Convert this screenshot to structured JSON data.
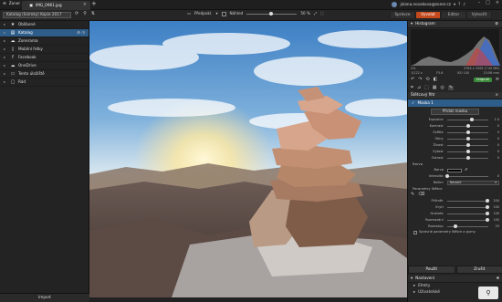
{
  "topbar": {
    "menu_label": "Zoner",
    "tab_title": "IMG_0961.jpg",
    "user_email": "jolana.novakova@zoner.cz",
    "window_controls": [
      "minimize",
      "maximize",
      "close"
    ]
  },
  "toolbar": {
    "catalog_select": "Katalog (Snímky) Kopie 2017",
    "view_label": "Předpokl.",
    "compare_label": "Náhled",
    "zoom": "50 %"
  },
  "modes": [
    "Správce",
    "Vyvolat",
    "Editor",
    "Vytvořit"
  ],
  "active_mode": "Vyvolat",
  "sidebar": {
    "items": [
      {
        "label": "Oblíbené",
        "icon": "star-icon",
        "selected": false,
        "extra": ""
      },
      {
        "label": "Katalog",
        "icon": "catalog-icon",
        "selected": true,
        "extra": "⚙ ◷"
      },
      {
        "label": "Zonerama",
        "icon": "cloud-icon",
        "selected": false,
        "extra": ""
      },
      {
        "label": "Mobilní řetky",
        "icon": "phone-icon",
        "selected": false,
        "extra": ""
      },
      {
        "label": "Facebook",
        "icon": "facebook-icon",
        "selected": false,
        "extra": ""
      },
      {
        "label": "OneDrive",
        "icon": "onedrive-icon",
        "selected": false,
        "extra": ""
      },
      {
        "label": "Tento úložiště",
        "icon": "computer-icon",
        "selected": false,
        "extra": ""
      },
      {
        "label": "Rád",
        "icon": "folder-icon",
        "selected": false,
        "extra": ""
      }
    ],
    "import_label": "Import"
  },
  "right": {
    "histogram_title": "Histogram",
    "hist_info_left": "2%",
    "hist_info_mid": "3784 x 2506 (7.40 MB)",
    "hist_info_row2": [
      "1/122 s",
      "F5.6",
      "ISO 100",
      "15:56 mm"
    ],
    "original_label": "Originál",
    "filter_title": "Štětcový filtr",
    "mask_label": "Maska 1",
    "add_mask_label": "Přidat masku",
    "sliders": [
      {
        "name": "Expozice",
        "value": "1.0",
        "pos": 0.58
      },
      {
        "name": "Kontrast",
        "value": "0",
        "pos": 0.5
      },
      {
        "name": "Světla",
        "value": "0",
        "pos": 0.5
      },
      {
        "name": "Stíny",
        "value": "0",
        "pos": 0.5
      },
      {
        "name": "Živost",
        "value": "0",
        "pos": 0.5
      },
      {
        "name": "Sytost",
        "value": "0",
        "pos": 0.5
      },
      {
        "name": "Ostrost",
        "value": "0",
        "pos": 0.5
      }
    ],
    "color_label": "Barva",
    "color_sub": "Barva",
    "intensity_label": "Intenzita",
    "intensity_value": "0",
    "mode_label": "Režim",
    "mode_value": "Násobit",
    "brush_params_label": "Parametry štětce",
    "brush_sliders": [
      {
        "name": "Průměr",
        "value": "200",
        "pos": 0.95
      },
      {
        "name": "Krytí",
        "value": "100",
        "pos": 0.95
      },
      {
        "name": "Hustota",
        "value": "100",
        "pos": 0.95
      },
      {
        "name": "Rozmazání",
        "value": "100",
        "pos": 0.95
      },
      {
        "name": "Rozestup",
        "value": "25",
        "pos": 0.2
      }
    ],
    "smart_brush_label": "Správné parametry štětce a gumy",
    "apply_label": "Použít",
    "close_label": "Zrušit",
    "navigator_title": "Nastavení",
    "nav_items": [
      "Efekty",
      "Uživatelské"
    ]
  },
  "colors": {
    "accent": "#c44a1d",
    "selection": "#2f5d8a",
    "original_badge": "#3b8a3b"
  }
}
